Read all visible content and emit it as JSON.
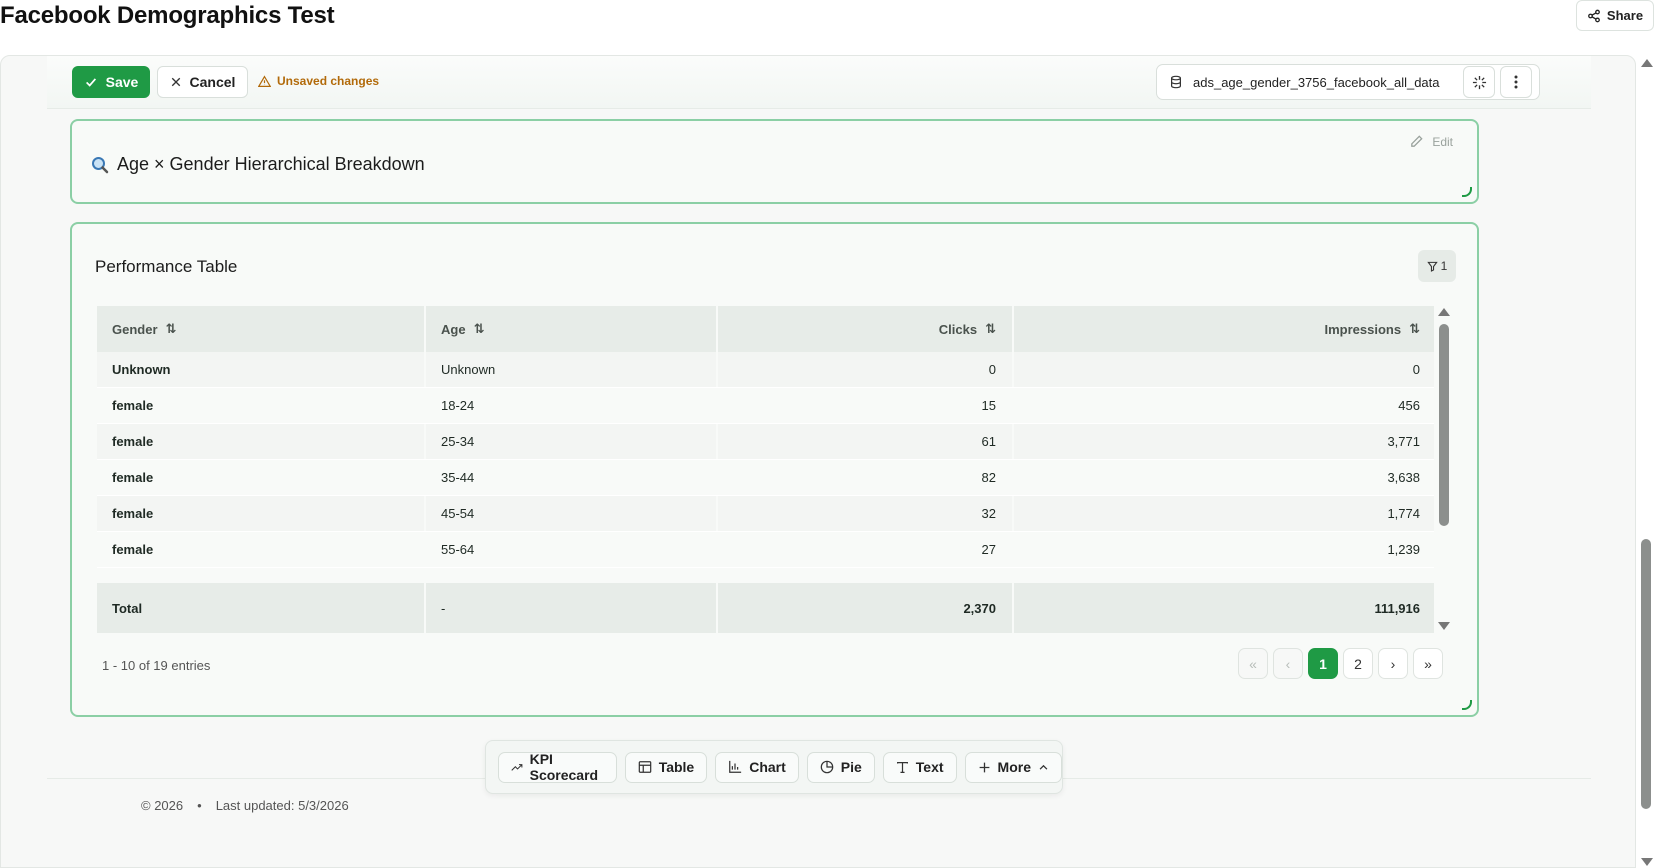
{
  "header": {
    "title": "Facebook Demographics Test",
    "share_label": "Share"
  },
  "toolbar": {
    "save_label": "Save",
    "cancel_label": "Cancel",
    "unsaved_label": "Unsaved changes",
    "data_source": "ads_age_gender_3756_facebook_all_data"
  },
  "text_widget": {
    "heading": "Age × Gender Hierarchical Breakdown",
    "edit_label": "Edit"
  },
  "table_widget": {
    "title": "Performance Table",
    "filter_count": "1",
    "columns": [
      "Gender",
      "Age",
      "Clicks",
      "Impressions"
    ],
    "rows": [
      [
        "Unknown",
        "Unknown",
        "0",
        "0"
      ],
      [
        "female",
        "18-24",
        "15",
        "456"
      ],
      [
        "female",
        "25-34",
        "61",
        "3,771"
      ],
      [
        "female",
        "35-44",
        "82",
        "3,638"
      ],
      [
        "female",
        "45-54",
        "32",
        "1,774"
      ],
      [
        "female",
        "55-64",
        "27",
        "1,239"
      ]
    ],
    "total": [
      "Total",
      "-",
      "2,370",
      "111,916"
    ],
    "entries_text": "1 - 10 of 19 entries",
    "pages": [
      "1",
      "2"
    ],
    "current_page": "1"
  },
  "add_bar": {
    "kpi_label": "KPI Scorecard",
    "table_label": "Table",
    "chart_label": "Chart",
    "pie_label": "Pie",
    "text_label": "Text",
    "more_label": "More"
  },
  "footer": {
    "copyright": "© 2026",
    "separator": "•",
    "updated": "Last updated: 5/3/2026"
  },
  "colors": {
    "accent": "#1f9a45",
    "card_border": "#8bcfa5",
    "warning": "#b26a0a"
  }
}
